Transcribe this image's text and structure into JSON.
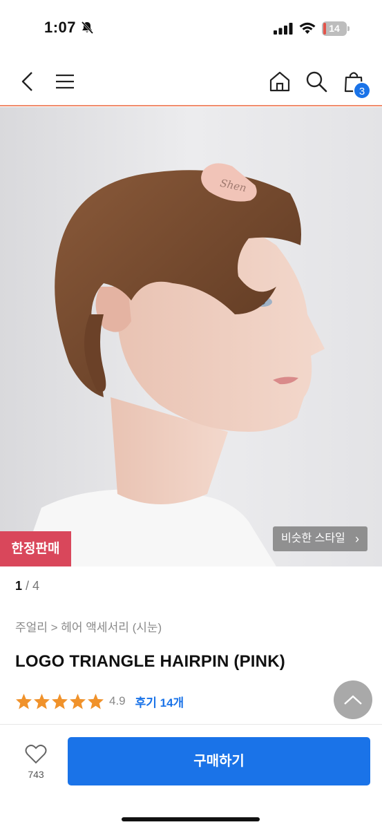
{
  "status_bar": {
    "time": "1:07",
    "battery_level": "14",
    "battery_fraction": 0.14,
    "icons": [
      "bell-slash-icon",
      "signal-icon",
      "wifi-icon",
      "battery-icon"
    ]
  },
  "nav": {
    "icons": [
      "back-icon",
      "menu-icon",
      "home-icon",
      "search-icon",
      "shopping-bag-icon"
    ],
    "cart_count": "3"
  },
  "hero": {
    "limited_badge": "한정판매",
    "similar_style_label": "비슷한 스타일",
    "similar_style_chevron": "›",
    "clip_logo_text": "Shen"
  },
  "product": {
    "pager_current": "1",
    "pager_total": " / 4",
    "breadcrumb": "주얼리 > 헤어 액세서리 (시눈)",
    "title": "LOGO TRIANGLE HAIRPIN (PINK)",
    "rating": "4.9",
    "rating_stars": 5,
    "review_label": "후기 14개"
  },
  "bottom": {
    "like_count": "743",
    "buy_label": "구매하기"
  },
  "colors": {
    "accent": "#1a73e8",
    "badge": "#d9475b",
    "nav_border": "#f08a6a",
    "star": "#f0922b"
  }
}
